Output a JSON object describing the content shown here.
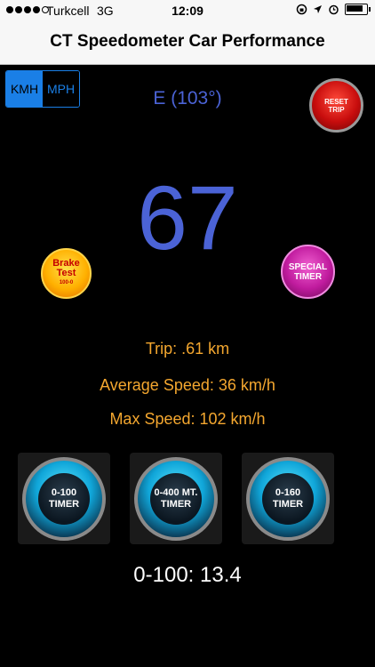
{
  "status_bar": {
    "carrier": "Turkcell",
    "network": "3G",
    "time": "12:09"
  },
  "title": "CT Speedometer Car Performance",
  "units": {
    "kmh": "KMH",
    "mph": "MPH",
    "selected": "KMH"
  },
  "heading": "E (103°)",
  "reset_trip": {
    "line1": "RESET",
    "line2": "TRIP"
  },
  "speed": "67",
  "brake_test": {
    "line1": "Brake",
    "line2": "Test",
    "line3": "100-0"
  },
  "special_timer": {
    "line1": "SPECIAL",
    "line2": "TIMER"
  },
  "trip": "Trip: .61 km",
  "average_speed": "Average Speed: 36 km/h",
  "max_speed": "Max Speed: 102 km/h",
  "timers": [
    {
      "line1": "0-100",
      "line2": "TIMER"
    },
    {
      "line1": "0-400 MT.",
      "line2": "TIMER"
    },
    {
      "line1": "0-160",
      "line2": "TIMER"
    }
  ],
  "result": "0-100: 13.4",
  "colors": {
    "accent_blue": "#1a7fe6",
    "speed_blue": "#4b63d6",
    "stat_orange": "#f4a72f"
  }
}
